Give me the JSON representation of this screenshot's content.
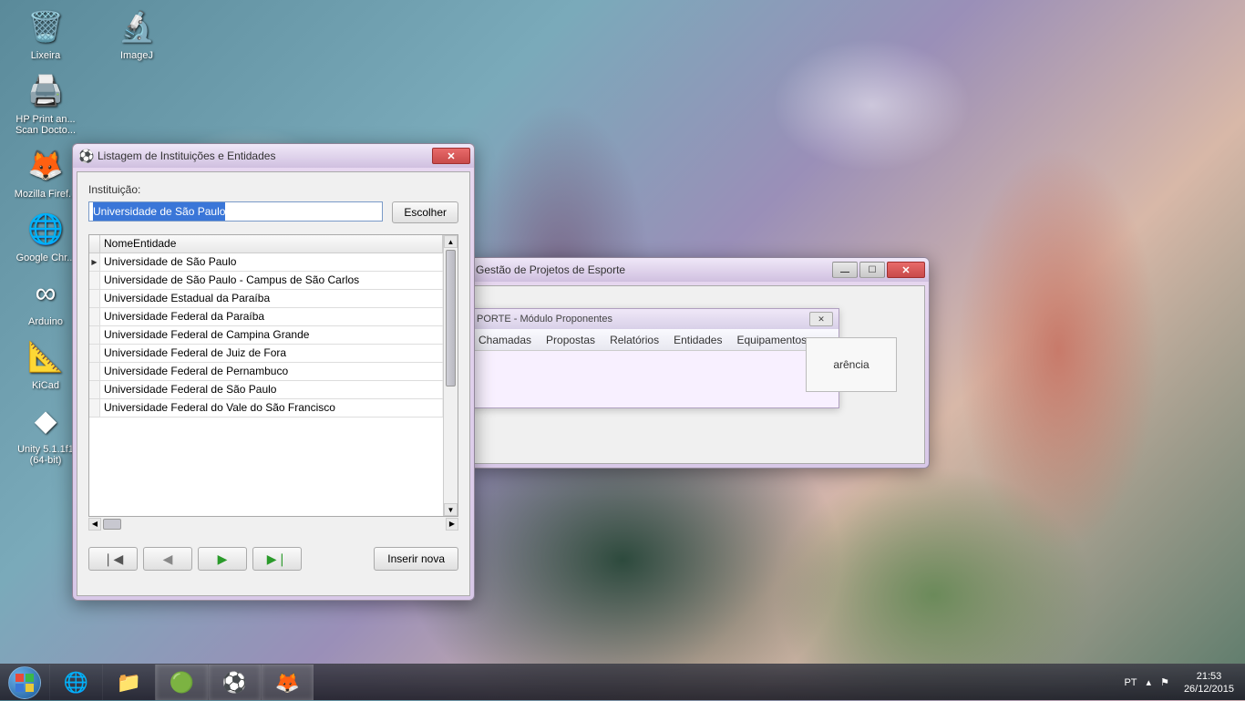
{
  "desktop": {
    "icons_col1": [
      {
        "label": "Lixeira",
        "glyph": "🗑️"
      },
      {
        "label": "HP Print an... Scan Docto...",
        "glyph": "🖨️"
      },
      {
        "label": "Mozilla Firef...",
        "glyph": "🦊"
      },
      {
        "label": "Google Chr...",
        "glyph": "🌐"
      },
      {
        "label": "Arduino",
        "glyph": "∞"
      },
      {
        "label": "KiCad",
        "glyph": "📐"
      },
      {
        "label": "Unity 5.1.1f1 (64-bit)",
        "glyph": "◆"
      }
    ],
    "icons_col2": [
      {
        "label": "ImageJ",
        "glyph": "🔬"
      }
    ]
  },
  "back_window": {
    "title": "Gestão de Projetos de Esporte",
    "child_title": "PORTE - Módulo Proponentes",
    "menu": [
      "Chamadas",
      "Propostas",
      "Relatórios",
      "Entidades",
      "Equipamentos"
    ],
    "button": "arência"
  },
  "front_window": {
    "title": "Listagem de Instituições e Entidades",
    "label": "Instituição:",
    "input_value": "Universidade de São Paulo",
    "choose_btn": "Escolher",
    "column_header": "NomeEntidade",
    "rows": [
      "Universidade de São Paulo",
      "Universidade de São Paulo - Campus de São Carlos",
      "Universidade Estadual da Paraíba",
      "Universidade Federal da Paraíba",
      "Universidade Federal de Campina Grande",
      "Universidade Federal de Juiz de Fora",
      "Universidade Federal de Pernambuco",
      "Universidade Federal de São Paulo",
      "Universidade Federal do Vale do São Francisco"
    ],
    "insert_btn": "Inserir nova"
  },
  "taskbar": {
    "lang": "PT",
    "time": "21:53",
    "date": "26/12/2015"
  }
}
